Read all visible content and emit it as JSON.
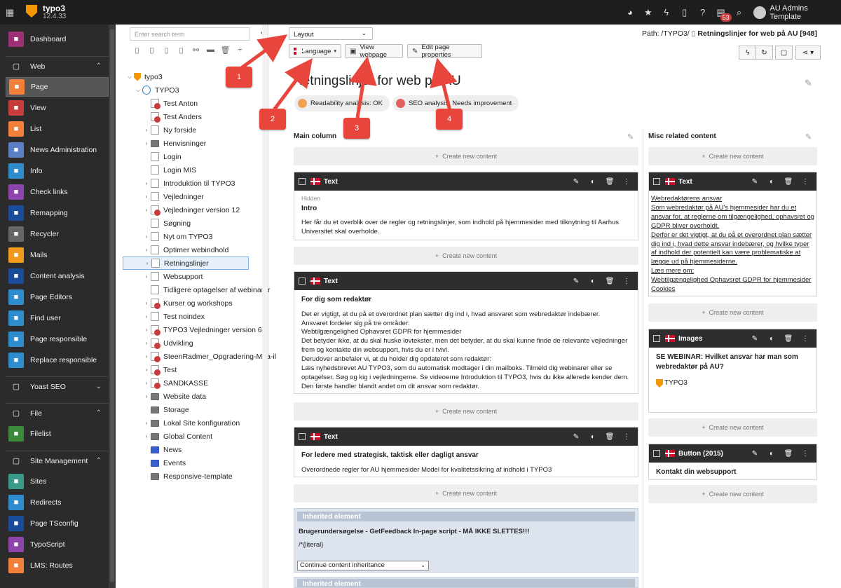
{
  "topbar": {
    "app_title": "typo3",
    "version": "12.4.33",
    "badge": "53",
    "user": "AU Admins Template"
  },
  "modules": [
    {
      "label": "Dashboard",
      "color": "#9e2f73",
      "icon": "dashboard-icon"
    },
    {
      "label": "Web",
      "group": true,
      "icon": "web-icon"
    },
    {
      "label": "Page",
      "color": "#f0803a",
      "active": true,
      "icon": "page-icon"
    },
    {
      "label": "View",
      "color": "#c83c3c",
      "icon": "view-icon"
    },
    {
      "label": "List",
      "color": "#f0803a",
      "icon": "list-icon"
    },
    {
      "label": "News Administration",
      "color": "#5d7fc7",
      "icon": "news-icon"
    },
    {
      "label": "Info",
      "color": "#2e8ccf",
      "icon": "info-icon"
    },
    {
      "label": "Check links",
      "color": "#8e44ad",
      "icon": "link-icon"
    },
    {
      "label": "Remapping",
      "color": "#1a4c9c",
      "icon": "remapping-icon"
    },
    {
      "label": "Recycler",
      "color": "#666666",
      "icon": "trash-icon"
    },
    {
      "label": "Mails",
      "color": "#f09a1f",
      "icon": "mail-icon"
    },
    {
      "label": "Content analysis",
      "color": "#1a4c9c",
      "icon": "analysis-icon"
    },
    {
      "label": "Page Editors",
      "color": "#2e8ccf",
      "icon": "user-icon"
    },
    {
      "label": "Find user",
      "color": "#2e8ccf",
      "icon": "user-icon"
    },
    {
      "label": "Page responsible",
      "color": "#2e8ccf",
      "icon": "user-icon"
    },
    {
      "label": "Replace responsible",
      "color": "#2e8ccf",
      "icon": "user-icon"
    },
    {
      "label": "Yoast SEO",
      "group": true,
      "icon": "yoast-icon"
    },
    {
      "label": "File",
      "group": true,
      "icon": "file-icon"
    },
    {
      "label": "Filelist",
      "color": "#3a8a3a",
      "icon": "filelist-icon"
    },
    {
      "label": "Site Management",
      "group": true,
      "icon": "site-icon"
    },
    {
      "label": "Sites",
      "color": "#3a9a8a",
      "icon": "sites-icon"
    },
    {
      "label": "Redirects",
      "color": "#2e8ccf",
      "icon": "redirect-icon"
    },
    {
      "label": "Page TSconfig",
      "color": "#1a4c9c",
      "icon": "tsconfig-icon"
    },
    {
      "label": "TypoScript",
      "color": "#8e44ad",
      "icon": "typoscript-icon"
    },
    {
      "label": "LMS: Routes",
      "color": "#f0803a",
      "icon": "routes-icon"
    }
  ],
  "tree": {
    "search_placeholder": "Enter search term",
    "root": "typo3",
    "site": "TYPO3",
    "nodes": [
      {
        "label": "Test Anton",
        "type": "red",
        "toggle": false
      },
      {
        "label": "Test Anders",
        "type": "red",
        "toggle": false
      },
      {
        "label": "Ny forside",
        "type": "page",
        "toggle": true
      },
      {
        "label": "Henvisninger",
        "type": "folder",
        "toggle": true
      },
      {
        "label": "Login",
        "type": "page",
        "toggle": false
      },
      {
        "label": "Login MIS",
        "type": "page",
        "toggle": false
      },
      {
        "label": "Introduktion til TYPO3",
        "type": "page",
        "toggle": true
      },
      {
        "label": "Vejledninger",
        "type": "page",
        "toggle": true
      },
      {
        "label": "Vejledninger version 12",
        "type": "red",
        "toggle": true
      },
      {
        "label": "Søgning",
        "type": "page",
        "toggle": false
      },
      {
        "label": "Nyt om TYPO3",
        "type": "page",
        "toggle": true
      },
      {
        "label": "Optimer webindhold",
        "type": "page",
        "toggle": true
      },
      {
        "label": "Retningslinjer",
        "type": "page",
        "toggle": true,
        "selected": true
      },
      {
        "label": "Websupport",
        "type": "page",
        "toggle": true
      },
      {
        "label": "Tidligere optagelser af webinarer",
        "type": "page",
        "toggle": false
      },
      {
        "label": "Kurser og workshops",
        "type": "red",
        "toggle": true
      },
      {
        "label": "Test noindex",
        "type": "page",
        "toggle": true
      },
      {
        "label": "TYPO3 Vejledninger version 6.2",
        "type": "red",
        "toggle": true
      },
      {
        "label": "Udvikling",
        "type": "red",
        "toggle": true
      },
      {
        "label": "SteenRadmer_Opgradering-Maa-il",
        "type": "red",
        "toggle": true
      },
      {
        "label": "Test",
        "type": "red",
        "toggle": true
      },
      {
        "label": "SANDKASSE",
        "type": "red",
        "toggle": true
      },
      {
        "label": "Website data",
        "type": "folder",
        "toggle": true
      },
      {
        "label": "Storage",
        "type": "folder",
        "toggle": false
      },
      {
        "label": "Lokal Site konfiguration",
        "type": "folder",
        "toggle": true
      },
      {
        "label": "Global Content",
        "type": "folder",
        "toggle": true
      },
      {
        "label": "News",
        "type": "blue",
        "toggle": false
      },
      {
        "label": "Events",
        "type": "blue",
        "toggle": false
      },
      {
        "label": "Responsive-template",
        "type": "folder",
        "toggle": false
      }
    ]
  },
  "main": {
    "layout_select": "Layout",
    "language_btn": "Language",
    "view_btn": "View webpage",
    "edit_btn": "Edit page properties",
    "path_label": "Path: /TYPO3/",
    "path_page": "Retningslinjer for web på AU [948]",
    "page_title": "Retningslinjer for web på AU",
    "readability": "Readability analysis: OK",
    "seo": "SEO analysis: Needs improvement",
    "col_main": "Main column",
    "col_misc": "Misc related content",
    "create_new": "Create new content",
    "cards": {
      "c1": {
        "type": "Text",
        "hidden": "Hidden",
        "title": "Intro",
        "body": "Her får du et overblik over de regler og retningslinjer, som indhold på hjemmesider med tilknytning til Aarhus Universitet skal overholde."
      },
      "c2": {
        "type": "Text",
        "title": "For dig som redaktør",
        "body": [
          "Det er vigtigt, at du på et overordnet plan sætter dig ind i, hvad ansvaret som webredaktør indebærer.",
          "Ansvaret fordeler sig på tre områder:",
          "Webtilgængelighed Ophavsret GDPR for hjemmesider",
          "Det betyder ikke, at du skal huske lovtekster, men det betyder, at du skal kunne finde de relevante vejledninger frem og kontakte din websupport, hvis du er i tvivl.",
          "Derudover anbefaler vi, at du holder dig opdateret som redaktør:",
          "Læs nyhedsbrevet AU TYPO3, som du automatisk modtager i din mailboks.  Tilmeld dig webinarer eller se optagelser. Søg og kig i vejledningerne. Se videoerne Introduktion til TYPO3, hvis du ikke allerede kender dem. Den første handler blandt andet om dit ansvar som redaktør."
        ]
      },
      "c3": {
        "type": "Text",
        "title": "For ledere med strategisk, taktisk eller dagligt ansvar",
        "body": "Overordnede regler for AU hjemmesider Model for kvalitetssikring af indhold i TYPO3"
      },
      "inh1": {
        "label": "Inherited element",
        "title": "Brugerundersøgelse - GetFeedback In-page script - MÅ IKKE SLETTES!!!",
        "code": "/*{literal}",
        "select": "Continue content inheritance"
      },
      "inh2": {
        "label": "Inherited element"
      },
      "r1": {
        "type": "Text",
        "lines": [
          "Webredaktørens ansvar",
          "Som webredaktør på AU's hjemmesider har du et ansvar for, at reglerne om tilgængelighed, ophavsret og GDPR bliver overholdt.",
          "Derfor er det vigtigt, at du på et overordnet plan sætter dig ind i, hvad dette ansvar indebærer, og hvilke typer af indhold der potentielt kan være problematiske at lægge ud på hjemmesiderne.",
          "Læs mere om:",
          "Webtilgængelighed Ophavsret GDPR for hjemmesider Cookies"
        ]
      },
      "r2": {
        "type": "Images",
        "title": "SE WEBINAR: Hvilket ansvar har man som webredaktør på AU?",
        "img_text": "TYPO3"
      },
      "r3": {
        "type": "Button (2015)",
        "title": "Kontakt din websupport"
      }
    }
  },
  "annotations": [
    "1",
    "2",
    "3",
    "4"
  ],
  "colors": {
    "accent": "#e8453c",
    "topbar": "#1e1e1e",
    "module_bg": "#2b2b2b"
  }
}
